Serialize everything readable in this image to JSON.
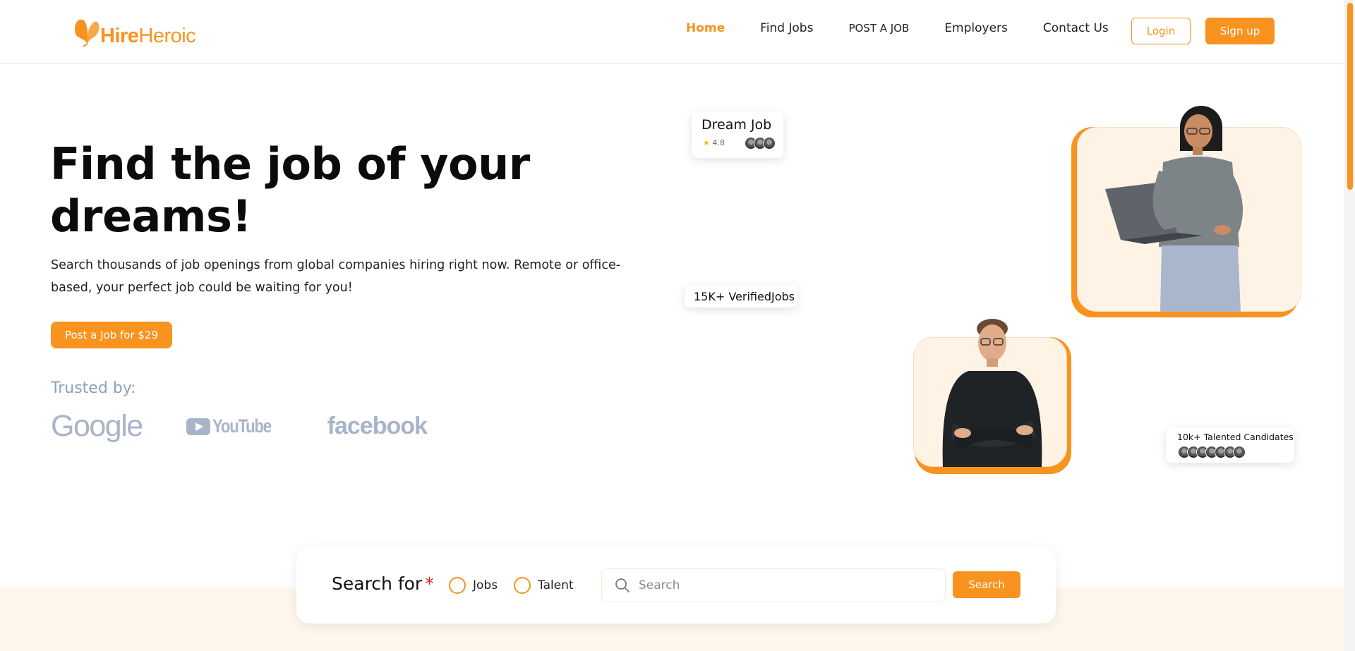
{
  "brand": {
    "name_part1": "Hire",
    "name_part2": "Heroic"
  },
  "nav": {
    "items": [
      {
        "label": "Home",
        "active": true
      },
      {
        "label": "Find Jobs"
      },
      {
        "label": "POST A JOB"
      },
      {
        "label": "Employers"
      },
      {
        "label": "Contact Us"
      }
    ],
    "login_label": "Login",
    "signup_label": "Sign up"
  },
  "hero": {
    "title": "Find the job of your dreams!",
    "description": "Search thousands of job openings from global companies hiring right now. Remote or office-based, your perfect job could be waiting for you!",
    "cta_label": "Post a Job for $29",
    "trusted_label": "Trusted by:",
    "brands": [
      "Google",
      "YouTube",
      "facebook"
    ]
  },
  "cards": {
    "dream_job": {
      "title": "Dream Job",
      "rating": "4.8"
    },
    "verified": {
      "title": "15K+ VerifiedJobs"
    },
    "candidates": {
      "title": "10k+ Talented Candidates"
    }
  },
  "search": {
    "label": "Search for",
    "required_mark": "*",
    "options": [
      "Jobs",
      "Talent"
    ],
    "placeholder": "Search",
    "value": "",
    "button_label": "Search"
  },
  "colors": {
    "accent": "#f7931e",
    "brand_gray": "#a7b4c9",
    "trusted_label": "#8da0bf",
    "band": "#fff6ec"
  }
}
